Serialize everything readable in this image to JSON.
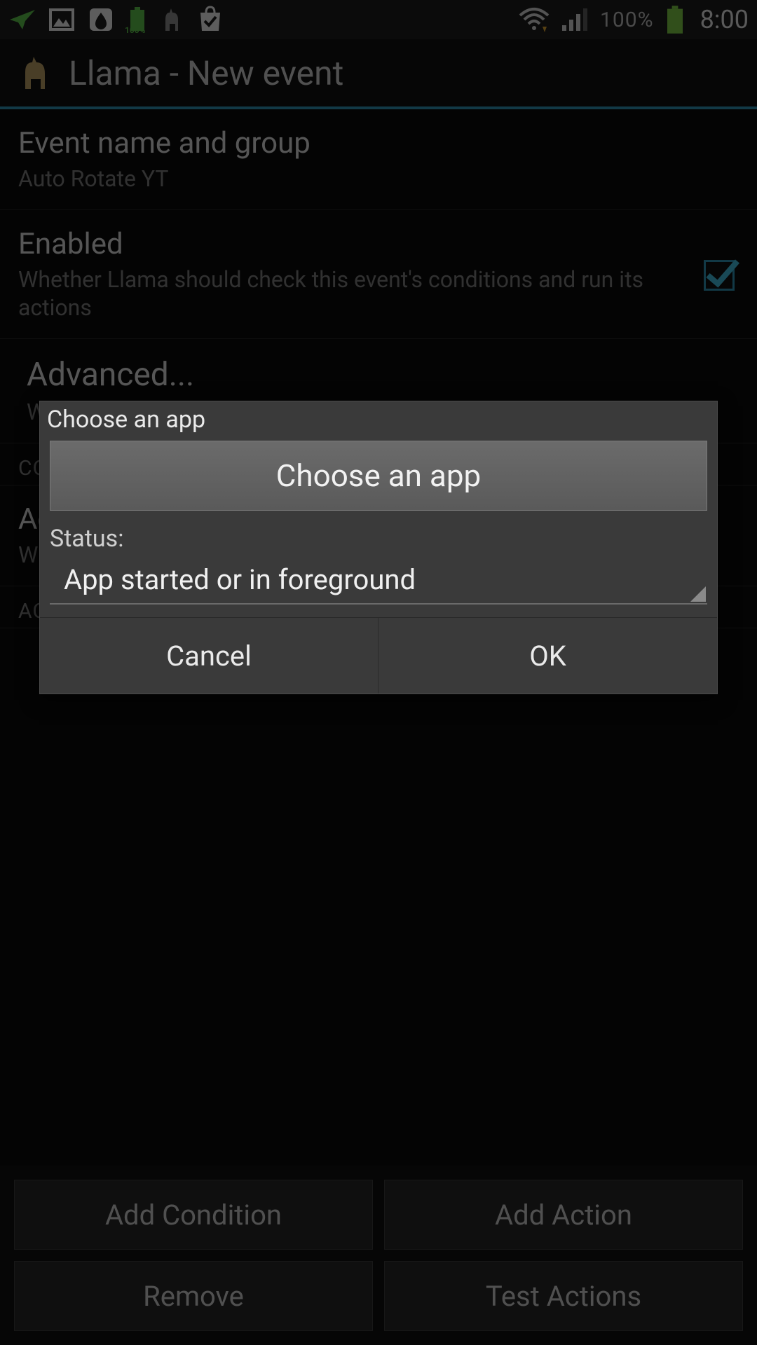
{
  "statusbar": {
    "battery_percent": "100%",
    "clock": "8:00",
    "small_batt_label": "100%"
  },
  "header": {
    "title": "Llama - New event"
  },
  "settings": {
    "event_name": {
      "title": "Event name and group",
      "value": "Auto Rotate YT"
    },
    "enabled": {
      "title": "Enabled",
      "subtitle": "Whether Llama should check this event's conditions and run its actions",
      "checked": true
    },
    "advanced": {
      "title": "Advanced...",
      "subtitle": "Whether this event is delayed or repeating, requires co"
    },
    "conditions_label": "CO",
    "active_app": {
      "title": "Ac",
      "subtitle": "Wh"
    },
    "actions_label": "AC"
  },
  "bottom_buttons": {
    "add_condition": "Add Condition",
    "add_action": "Add Action",
    "remove": "Remove",
    "test_actions": "Test Actions"
  },
  "dialog": {
    "title": "Choose an app",
    "choose_btn": "Choose an app",
    "status_label": "Status:",
    "status_value": "App started or in foreground",
    "cancel": "Cancel",
    "ok": "OK"
  }
}
